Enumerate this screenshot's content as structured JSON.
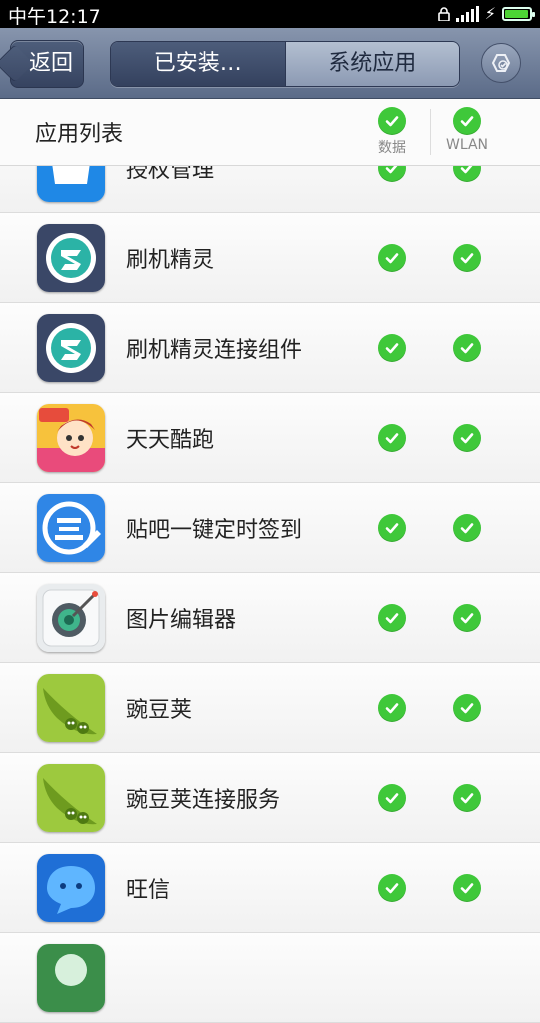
{
  "status": {
    "time": "中午12:17"
  },
  "nav": {
    "back_label": "返回",
    "tab_installed": "已安装…",
    "tab_system": "系统应用"
  },
  "header": {
    "title": "应用列表",
    "col_data": "数据",
    "col_wlan": "WLAN"
  },
  "apps": [
    {
      "name": "授权管理",
      "icon": "authorization-app-icon",
      "data": true,
      "wlan": true
    },
    {
      "name": "刷机精灵",
      "icon": "flash-wizard-app-icon",
      "data": true,
      "wlan": true
    },
    {
      "name": "刷机精灵连接组件",
      "icon": "flash-wizard-connector-app-icon",
      "data": true,
      "wlan": true
    },
    {
      "name": "天天酷跑",
      "icon": "daily-run-game-icon",
      "data": true,
      "wlan": true
    },
    {
      "name": "贴吧一键定时签到",
      "icon": "tieba-signin-app-icon",
      "data": true,
      "wlan": true
    },
    {
      "name": "图片编辑器",
      "icon": "photo-editor-app-icon",
      "data": true,
      "wlan": true
    },
    {
      "name": "豌豆荚",
      "icon": "wandoujia-app-icon",
      "data": true,
      "wlan": true
    },
    {
      "name": "豌豆荚连接服务",
      "icon": "wandoujia-connector-app-icon",
      "data": true,
      "wlan": true
    },
    {
      "name": "旺信",
      "icon": "wangxin-app-icon",
      "data": true,
      "wlan": true
    },
    {
      "name": "",
      "icon": "partial-app-icon",
      "data": false,
      "wlan": false
    }
  ],
  "colors": {
    "check_green": "#3fc83a",
    "titlebar": "#6d7c97"
  }
}
